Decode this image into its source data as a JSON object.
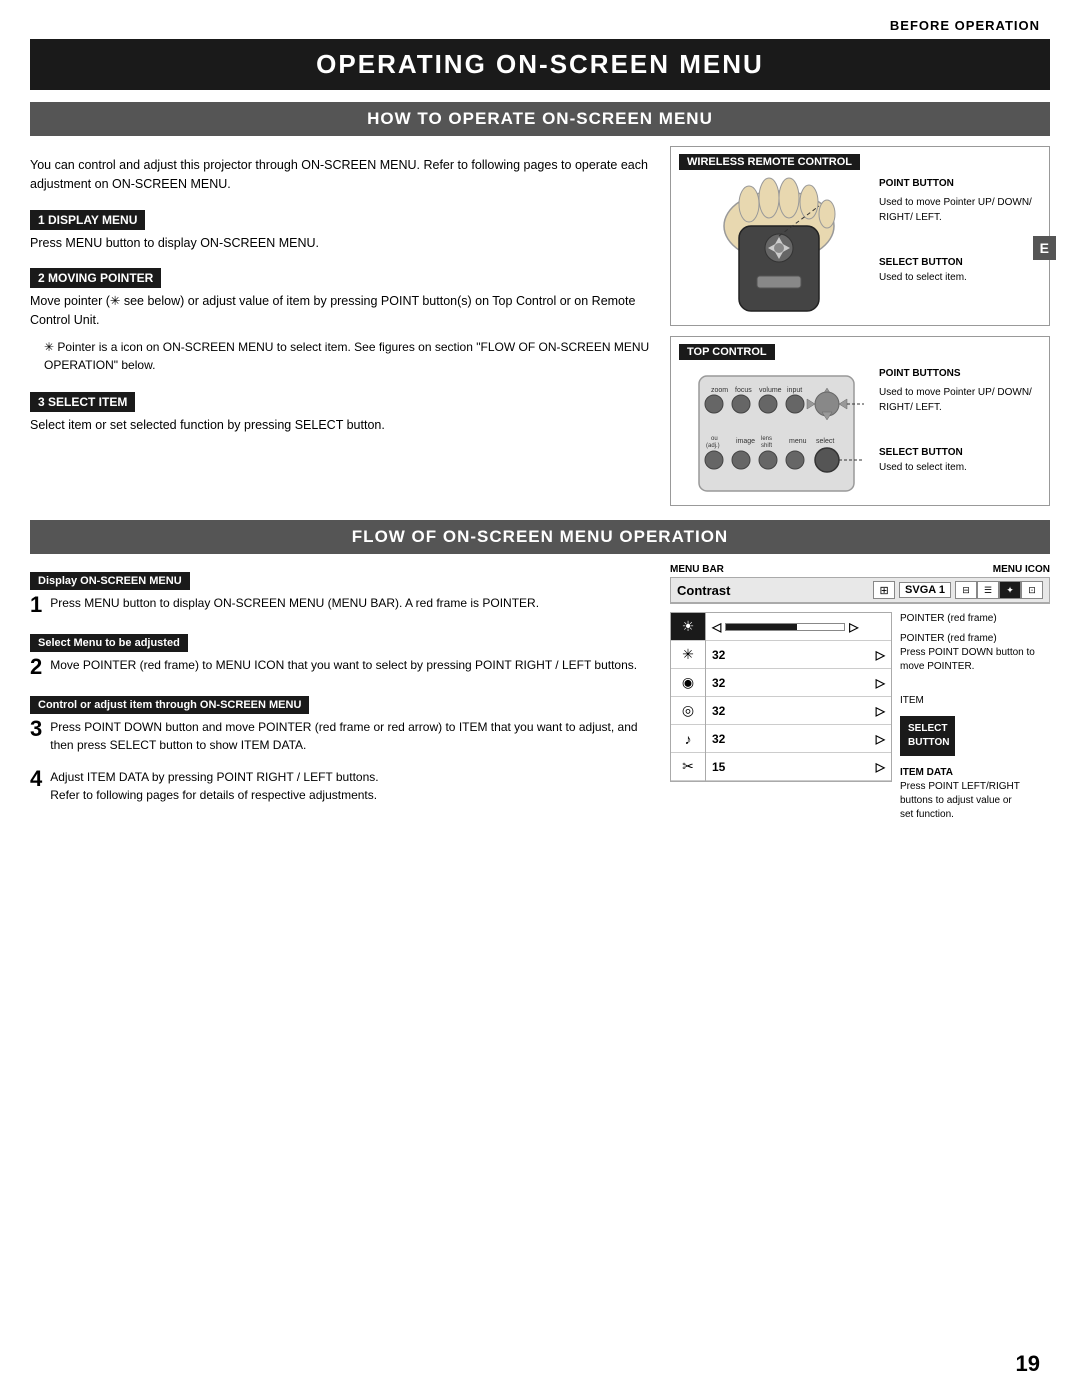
{
  "page": {
    "header": "BEFORE OPERATION",
    "main_title": "OPERATING ON-SCREEN MENU",
    "page_number": "19"
  },
  "section1": {
    "title": "HOW TO OPERATE ON-SCREEN MENU",
    "intro": "You can control and adjust this projector through ON-SCREEN MENU.  Refer to following pages to operate each adjustment on ON-SCREEN MENU.",
    "display_menu": {
      "label": "1  DISPLAY MENU",
      "text": "Press MENU button to display ON-SCREEN MENU."
    },
    "moving_pointer": {
      "label": "2  MOVING POINTER",
      "text": "Move pointer (✳ see below) or adjust value of item by pressing POINT button(s) on Top Control or on Remote Control Unit."
    },
    "note": "✳  Pointer is a icon on ON-SCREEN MENU to select item. See figures on section \"FLOW OF ON-SCREEN MENU OPERATION\" below.",
    "select_item": {
      "label": "3  SELECT ITEM",
      "text": "Select item or set selected function by pressing SELECT button."
    },
    "wireless_remote": {
      "title": "WIRELESS REMOTE CONTROL",
      "point_button_label": "POINT BUTTON",
      "point_button_desc": "Used to move Pointer UP/ DOWN/ RIGHT/ LEFT.",
      "select_button_label": "SELECT BUTTON",
      "select_button_desc": "Used to select item."
    },
    "top_control": {
      "title": "TOP CONTROL",
      "point_buttons_label": "POINT BUTTONS",
      "point_buttons_desc": "Used to move Pointer UP/ DOWN/ RIGHT/ LEFT.",
      "select_button_label": "SELECT BUTTON",
      "select_button_desc": "Used to select item."
    }
  },
  "section2": {
    "title": "FLOW OF ON-SCREEN MENU OPERATION",
    "display_onscreen": {
      "label": "Display ON-SCREEN MENU",
      "step": "1",
      "text": "Press MENU button to display ON-SCREEN MENU (MENU BAR).  A red frame is POINTER."
    },
    "select_menu": {
      "label": "Select Menu to be adjusted",
      "step": "2",
      "text": "Move POINTER (red frame) to MENU ICON that you want to select by pressing POINT RIGHT / LEFT buttons."
    },
    "control_adjust": {
      "label": "Control or adjust item through ON-SCREEN MENU",
      "step": "3",
      "text": "Press POINT DOWN button and move POINTER (red frame or red arrow) to ITEM that you want to adjust, and then press SELECT button to show ITEM DATA."
    },
    "step4": {
      "step": "4",
      "text": "Adjust ITEM DATA by pressing POINT RIGHT / LEFT buttons.",
      "text2": "Refer to following pages for details of respective adjustments."
    },
    "menu_bar_label": "MENU BAR",
    "menu_icon_label": "MENU ICON",
    "pointer_label": "POINTER",
    "pointer_sublabel": "(red frame)",
    "pointer_desc": "POINTER (red frame)\nPress POINT DOWN button to\nmove POINTER.",
    "item_label": "ITEM",
    "select_button_box_line1": "SELECT",
    "select_button_box_line2": "BUTTON",
    "item_data_label": "ITEM DATA",
    "item_data_desc": "Press POINT LEFT/RIGHT\nbuttons to adjust value or\nset function.",
    "contrast_label": "Contrast",
    "svga_label": "SVGA 1",
    "menu_items": [
      {
        "icon": "☀",
        "value": "32",
        "active": false
      },
      {
        "icon": "✳",
        "value": "32",
        "active": false
      },
      {
        "icon": "◉",
        "value": "32",
        "active": false
      },
      {
        "icon": "◎",
        "value": "32",
        "active": false
      },
      {
        "icon": "♪",
        "value": "32",
        "active": false
      },
      {
        "icon": "✂",
        "value": "15",
        "active": false
      }
    ],
    "first_item_bar": true
  }
}
